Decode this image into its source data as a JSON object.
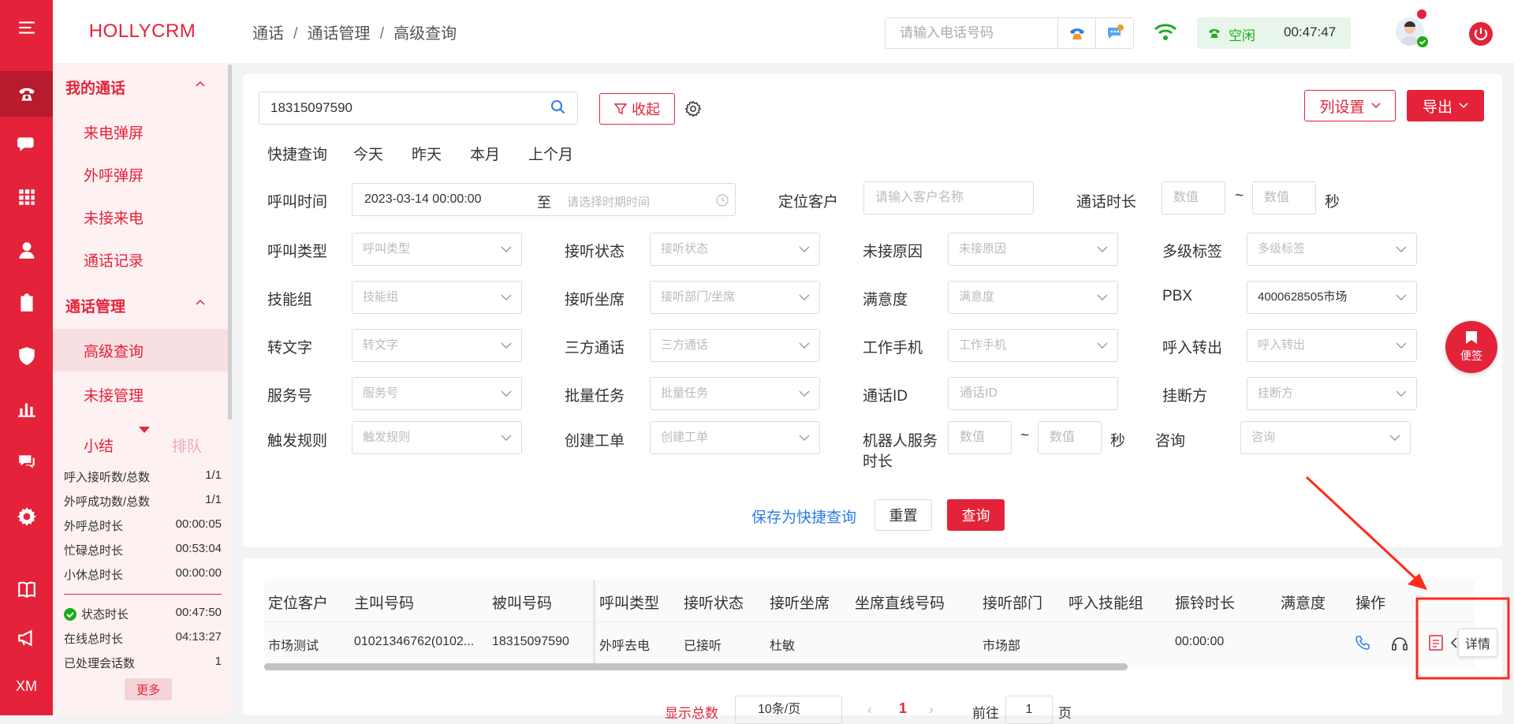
{
  "brand": "HOLLYCRM",
  "iconbar": {
    "items": [
      "menu-icon",
      "phone-icon",
      "chat-icon",
      "grid-icon",
      "user-icon",
      "clipboard-icon",
      "shield-icon",
      "chart-icon",
      "message-icon",
      "gear-icon",
      "book-icon",
      "megaphone-icon"
    ],
    "bottom_label": "XM"
  },
  "sidebar": {
    "group1": "我的通话",
    "group1_items": [
      "来电弹屏",
      "外呼弹屏",
      "未接来电",
      "通话记录"
    ],
    "group2": "通话管理",
    "group2_items": [
      "高级查询",
      "未接管理"
    ],
    "tabs": [
      "小结",
      "排队"
    ],
    "stats": [
      {
        "label": "呼入接听数/总数",
        "value": "1/1"
      },
      {
        "label": "外呼成功数/总数",
        "value": "1/1"
      },
      {
        "label": "外呼总时长",
        "value": "00:00:05"
      },
      {
        "label": "忙碌总时长",
        "value": "00:53:04"
      },
      {
        "label": "小休总时长",
        "value": "00:00:00"
      }
    ],
    "stats2": [
      {
        "label": "状态时长",
        "value": "00:47:50"
      },
      {
        "label": "在线总时长",
        "value": "04:13:27"
      },
      {
        "label": "已处理会话数",
        "value": "1"
      }
    ],
    "more": "更多"
  },
  "header": {
    "breadcrumb": [
      "通话",
      "通话管理",
      "高级查询"
    ],
    "phone_placeholder": "请输入电话号码",
    "status": "空闲",
    "timer": "00:47:47"
  },
  "search": {
    "value": "18315097590",
    "collapse": "收起",
    "col_settings": "列设置",
    "export": "导出"
  },
  "quick": {
    "label": "快捷查询",
    "items": [
      "今天",
      "昨天",
      "本月",
      "上个月"
    ]
  },
  "form": {
    "call_time": "呼叫时间",
    "start": "2023-03-14 00:00:00",
    "to": "至",
    "end_ph": "请选择时期时间",
    "locate": "定位客户",
    "locate_ph": "请输入客户名称",
    "duration": "通话时长",
    "num_ph": "数值",
    "tilde": "~",
    "sec": "秒",
    "rows": [
      [
        {
          "label": "呼叫类型",
          "ph": "呼叫类型"
        },
        {
          "label": "接听状态",
          "ph": "接听状态"
        },
        {
          "label": "未接原因",
          "ph": "未接原因"
        },
        {
          "label": "多级标签",
          "ph": "多级标签"
        }
      ],
      [
        {
          "label": "技能组",
          "ph": "技能组"
        },
        {
          "label": "接听坐席",
          "ph": "接听部门/坐席"
        },
        {
          "label": "满意度",
          "ph": "满意度"
        },
        {
          "label": "PBX",
          "ph": "4000628505市场"
        }
      ],
      [
        {
          "label": "转文字",
          "ph": "转文字"
        },
        {
          "label": "三方通话",
          "ph": "三方通话"
        },
        {
          "label": "工作手机",
          "ph": "工作手机"
        },
        {
          "label": "呼入转出",
          "ph": "呼入转出"
        }
      ],
      [
        {
          "label": "服务号",
          "ph": "服务号"
        },
        {
          "label": "批量任务",
          "ph": "批量任务"
        },
        {
          "label": "通话ID",
          "ph": "通话ID"
        },
        {
          "label": "挂断方",
          "ph": "挂断方"
        }
      ]
    ],
    "trigger": "触发规则",
    "trigger_ph": "触发规则",
    "ticket": "创建工单",
    "ticket_ph": "创建工单",
    "robot1": "机器人服务",
    "robot2": "时长",
    "consult": "咨询",
    "consult_ph": "咨询",
    "save_quick": "保存为快捷查询",
    "reset": "重置",
    "query": "查询"
  },
  "table": {
    "headers": [
      "定位客户",
      "主叫号码",
      "被叫号码",
      "呼叫类型",
      "接听状态",
      "接听坐席",
      "坐席直线号码",
      "接听部门",
      "呼入技能组",
      "振铃时长",
      "满意度",
      "操作"
    ],
    "rows": [
      [
        "市场测试",
        "01021346762(0102...",
        "18315097590",
        "外呼去电",
        "已接听",
        "杜敏",
        "",
        "市场部",
        "",
        "00:00:00",
        "",
        ""
      ]
    ],
    "tooltip": "详情"
  },
  "pager": {
    "total": "显示总数",
    "size": "10条/页",
    "page": "1",
    "goto": "前往",
    "goto_val": "1",
    "page_unit": "页"
  },
  "float_note": "便签",
  "colors": {
    "accent": "#e4233b",
    "status_green": "#1aad19"
  }
}
